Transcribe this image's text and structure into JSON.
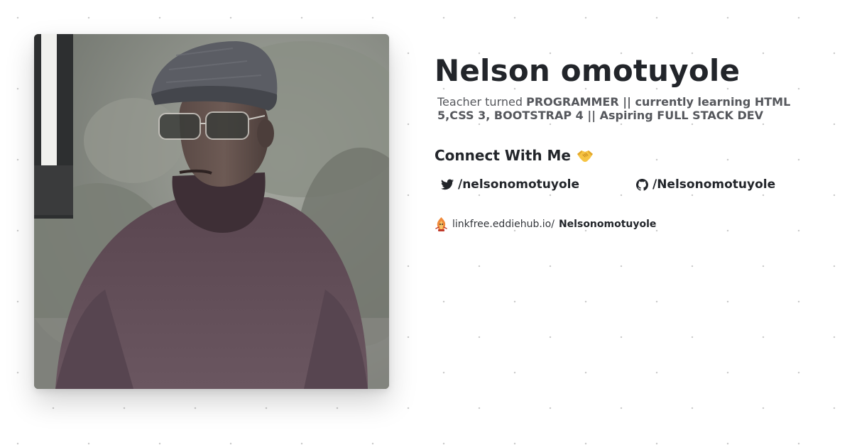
{
  "profile": {
    "name": "Nelson omotuyole",
    "photo_alt": "Profile photo",
    "bio": {
      "prefix": "Teacher turned ",
      "highlight": "PROGRAMMER || currently learning HTML 5,CSS 3, BOOTSTRAP 4 || Aspiring FULL STACK DEV"
    }
  },
  "connect": {
    "heading": "Connect With Me",
    "heading_icon": "handshake-icon",
    "links": [
      {
        "icon": "twitter-icon",
        "label": "/nelsonomotuyole"
      },
      {
        "icon": "github-icon",
        "label": "/Nelsonomotuyole"
      }
    ]
  },
  "linkfree": {
    "icon": "linkfree-logo-icon",
    "domain": "linkfree.eddiehub.io/",
    "username": "Nelsonomotuyole"
  },
  "colors": {
    "text_primary": "#22252a",
    "text_secondary": "#55575c",
    "background": "#ffffff",
    "dot_pattern": "#c9c9c9"
  }
}
